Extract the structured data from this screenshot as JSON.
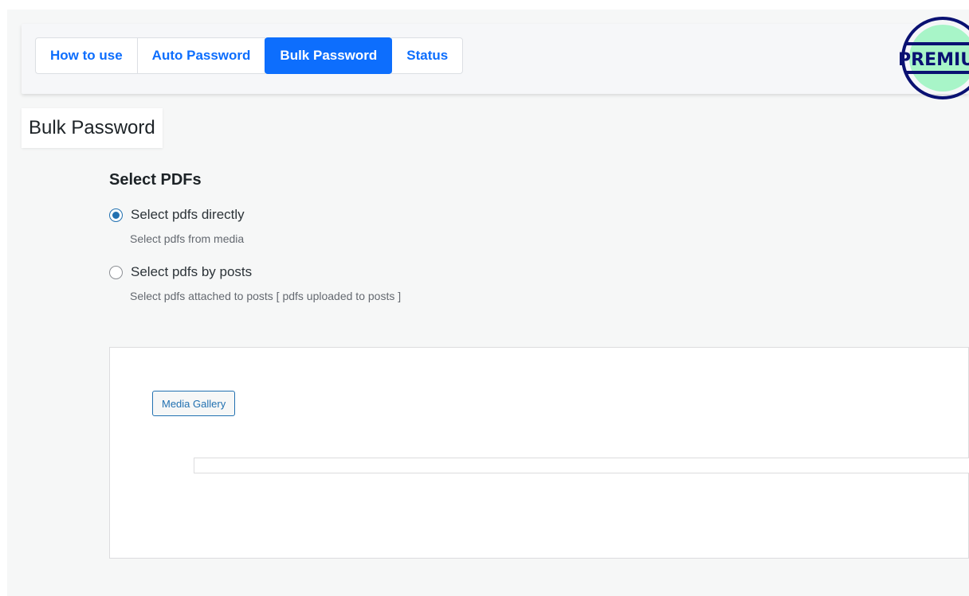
{
  "tabs": [
    {
      "label": "How to use",
      "active": false
    },
    {
      "label": "Auto Password",
      "active": false
    },
    {
      "label": "Bulk Password",
      "active": true
    },
    {
      "label": "Status",
      "active": false
    }
  ],
  "premium_badge": {
    "label": "PREMIUM",
    "ring_color": "#0a1172",
    "fill_color": "#a8f5c8"
  },
  "page_title": "Bulk Password",
  "select_section": {
    "title": "Select PDFs",
    "options": [
      {
        "label": "Select pdfs directly",
        "description": "Select pdfs from media",
        "checked": true
      },
      {
        "label": "Select pdfs by posts",
        "description": "Select pdfs attached to posts [ pdfs uploaded to posts ]",
        "checked": false
      }
    ]
  },
  "panel": {
    "media_button": "Media Gallery"
  },
  "colors": {
    "accent": "#0d6efd",
    "wp_blue": "#2271b1"
  }
}
